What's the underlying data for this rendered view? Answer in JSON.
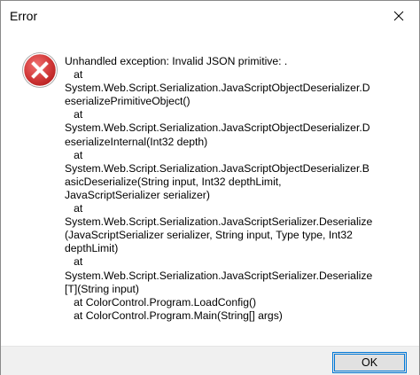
{
  "window": {
    "title": "Error",
    "close_icon": "close-icon"
  },
  "message": {
    "icon": "error-icon",
    "colors": {
      "icon_red": "#d23a3a",
      "icon_border": "#b51e1e"
    },
    "lines": [
      "Unhandled exception: Invalid JSON primitive: .",
      "   at",
      "System.Web.Script.Serialization.JavaScriptObjectDeserializer.D",
      "eserializePrimitiveObject()",
      "   at",
      "System.Web.Script.Serialization.JavaScriptObjectDeserializer.D",
      "eserializeInternal(Int32 depth)",
      "   at",
      "System.Web.Script.Serialization.JavaScriptObjectDeserializer.B",
      "asicDeserialize(String input, Int32 depthLimit,",
      "JavaScriptSerializer serializer)",
      "   at",
      "System.Web.Script.Serialization.JavaScriptSerializer.Deserialize",
      "(JavaScriptSerializer serializer, String input, Type type, Int32",
      "depthLimit)",
      "   at",
      "System.Web.Script.Serialization.JavaScriptSerializer.Deserialize",
      "[T](String input)",
      "   at ColorControl.Program.LoadConfig()",
      "   at ColorControl.Program.Main(String[] args)"
    ]
  },
  "footer": {
    "ok_label": "OK",
    "accent": "#0078d7"
  }
}
